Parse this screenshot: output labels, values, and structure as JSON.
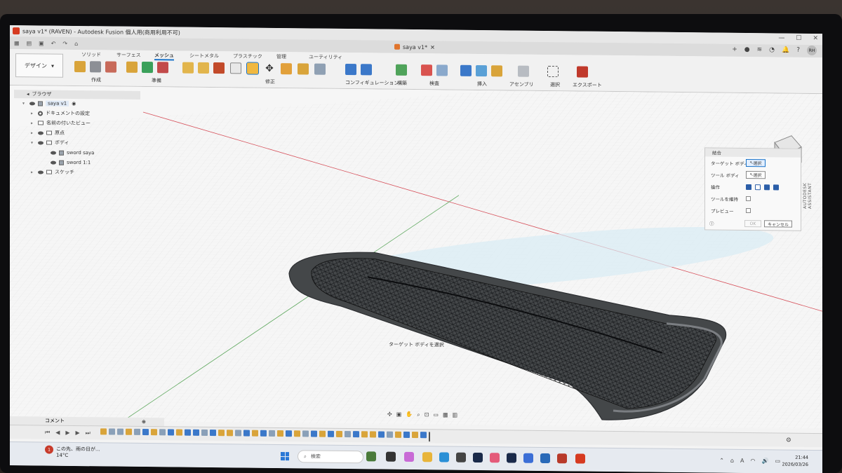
{
  "titlebar": {
    "title": "saya v1* (RAVEN) - Autodesk Fusion 個人用(商用利用不可)"
  },
  "tabbar": {
    "doc_tab": "saya v1*",
    "user_initials": "RH"
  },
  "ribbon": {
    "workspace": "デザイン",
    "tabs": [
      "ソリッド",
      "サーフェス",
      "メッシュ",
      "シートメタル",
      "プラスチック",
      "管理",
      "ユーティリティ"
    ],
    "active_tab": "メッシュ",
    "groups": [
      "作成",
      "準備",
      "修正",
      "コンフィギュレーション",
      "構築",
      "検査",
      "挿入",
      "アセンブリ",
      "選択",
      "エクスポート"
    ]
  },
  "browser": {
    "title": "ブラウザ",
    "items": [
      {
        "label": "saya v1",
        "level": 0
      },
      {
        "label": "ドキュメントの設定",
        "level": 1
      },
      {
        "label": "名前の付いたビュー",
        "level": 1
      },
      {
        "label": "原点",
        "level": 1
      },
      {
        "label": "ボディ",
        "level": 1
      },
      {
        "label": "sword saya",
        "level": 2
      },
      {
        "label": "sword 1:1",
        "level": 2
      },
      {
        "label": "スケッチ",
        "level": 1
      }
    ]
  },
  "dialog": {
    "title": "結合",
    "target_label": "ターゲット ボディ",
    "tool_label": "ツール ボディ",
    "select_label": "選択",
    "operation_label": "操作",
    "keep_tools_label": "ツールを維持",
    "preview_label": "プレビュー",
    "ok_label": "OK",
    "cancel_label": "キャンセル",
    "assistant": "AUTODESK ASSISTANT"
  },
  "viewport": {
    "tooltip": "ターゲット ボディを選択"
  },
  "bottom": {
    "comments": "コメント"
  },
  "taskbar": {
    "weather_text": "この先、雨の日が...",
    "weather_temp": "14°C",
    "weather_badge": "1",
    "search_placeholder": "検索",
    "time": "21:44",
    "date": "2026/03/26",
    "lang": "A"
  },
  "colors": {
    "accent": "#1a73c9",
    "grid": "#d4d4d4",
    "x_axis": "#d6505a",
    "y_axis": "#5aa65a",
    "body": "#3f4246"
  }
}
